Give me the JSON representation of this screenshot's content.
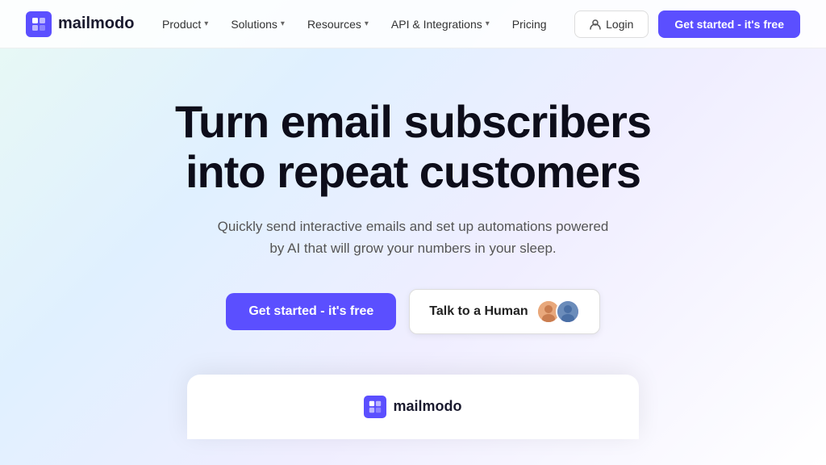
{
  "logo": {
    "icon_text": "m",
    "text": "mailmodo"
  },
  "nav": {
    "links": [
      {
        "label": "Product",
        "has_dropdown": true
      },
      {
        "label": "Solutions",
        "has_dropdown": true
      },
      {
        "label": "Resources",
        "has_dropdown": true
      },
      {
        "label": "API & Integrations",
        "has_dropdown": true
      },
      {
        "label": "Pricing",
        "has_dropdown": false
      }
    ],
    "login_label": "Login",
    "get_started_label": "Get started - it's free"
  },
  "hero": {
    "title_line1": "Turn email subscribers",
    "title_line2": "into repeat customers",
    "subtitle": "Quickly send interactive emails and set up automations powered by AI that will grow your numbers in your sleep.",
    "cta_primary": "Get started - it's free",
    "cta_secondary": "Talk to a Human"
  },
  "preview": {
    "logo_icon": "m",
    "logo_text": "mailmodo"
  },
  "colors": {
    "accent": "#5b4fff",
    "text_dark": "#0d0d1a",
    "text_muted": "#555"
  }
}
